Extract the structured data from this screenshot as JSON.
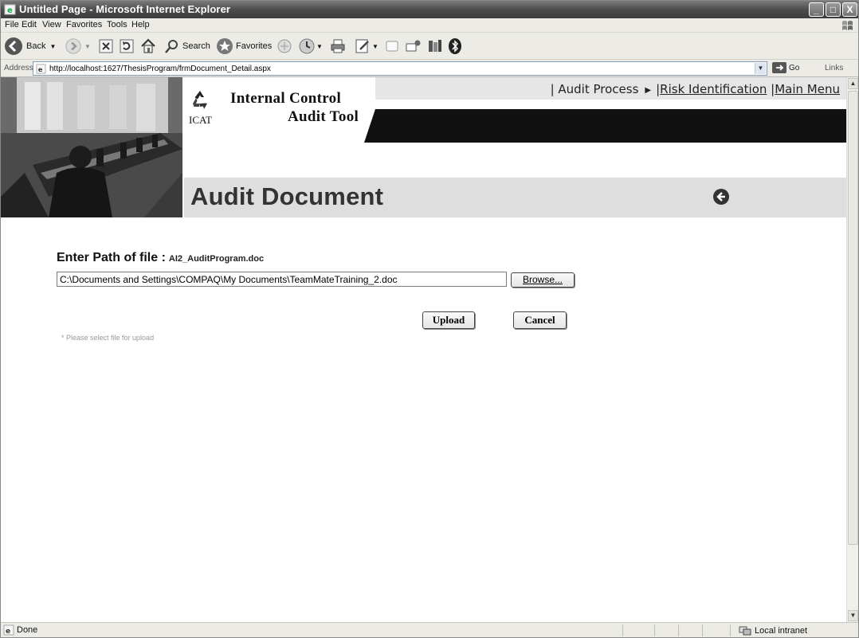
{
  "window": {
    "title": "Untitled Page - Microsoft Internet Explorer",
    "minimize": "_",
    "maximize": "□",
    "close": "X"
  },
  "menu": [
    "File",
    "Edit",
    "View",
    "Favorites",
    "Tools",
    "Help"
  ],
  "toolbar": {
    "back_label": "Back",
    "search_label": "Search",
    "favorites_label": "Favorites"
  },
  "address": {
    "label": "Address",
    "url": "http://localhost:1627/ThesisProgram/frmDocument_Detail.aspx",
    "go_label": "Go",
    "links_label": "Links"
  },
  "nav": {
    "current": "| Audit Process",
    "risk": "Risk Identification",
    "main": "Main Menu"
  },
  "logo": {
    "line1": "Internal Control",
    "line2": "Audit Tool",
    "abbr": "ICAT"
  },
  "page": {
    "title": "Audit Document"
  },
  "form": {
    "label": "Enter Path of file :",
    "filename": "AI2_AuditProgram.doc",
    "path_value": "C:\\Documents and Settings\\COMPAQ\\My Documents\\TeamMateTraining_2.doc",
    "browse": "Browse...",
    "upload": "Upload",
    "cancel": "Cancel",
    "hint": "* Please select file for upload"
  },
  "status": {
    "text": "Done",
    "zone": "Local intranet"
  },
  "colors": {
    "titlebar": "#4d4d4d",
    "banner": "#dedede",
    "header_black": "#111111"
  }
}
